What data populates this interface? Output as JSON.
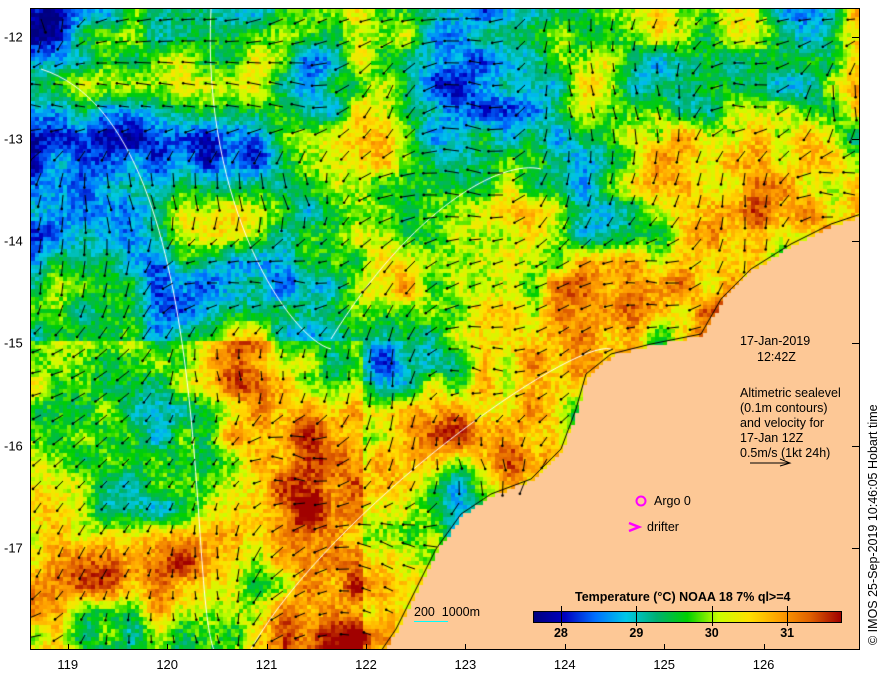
{
  "map": {
    "lon_ticks": [
      "119",
      "120",
      "121",
      "122",
      "123",
      "124",
      "125",
      "126"
    ],
    "lat_ticks": [
      "-12",
      "-13",
      "-14",
      "-15",
      "-16",
      "-17"
    ],
    "lon_range": [
      118.62,
      126.97
    ],
    "lat_range": [
      -18.0,
      -11.72
    ],
    "land_color": "#fdc896"
  },
  "annotations": {
    "date": "17-Jan-2019",
    "time": "12:42Z",
    "altimetry": "Altimetric sealevel\n(0.1m contours)\nand velocity for\n17-Jan 12Z\n0.5m/s (1kt 24h)",
    "argo": "Argo 0",
    "drifter": "drifter",
    "depth_legend": "200  1000m",
    "stamp": "© IMOS 25-Sep-2019 10:46:05 Hobart time"
  },
  "colorbar": {
    "title": "Temperature (°C) NOAA 18 7% ql>=4",
    "ticks": [
      "28",
      "29",
      "30",
      "31"
    ],
    "range": [
      27.63,
      31.7
    ],
    "colors": [
      "#00007f",
      "#0000c0",
      "#0070ff",
      "#00c8e8",
      "#00b070",
      "#00d000",
      "#c8ff00",
      "#ffe000",
      "#ffa000",
      "#e06000",
      "#a00000"
    ]
  }
}
